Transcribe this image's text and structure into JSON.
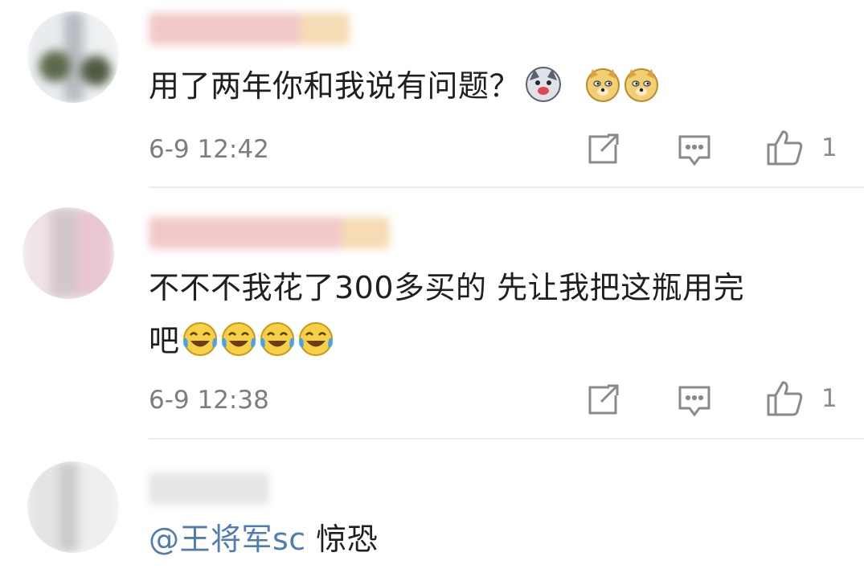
{
  "comments": [
    {
      "text_parts": [
        "用了两年你和我说有问题？"
      ],
      "emojis": [
        "husky-emoji",
        "doge-emoji",
        "doge-emoji"
      ],
      "time": "6-9 12:42",
      "likes": "1"
    },
    {
      "text_parts": [
        "不不不我花了300多买的 先让我把这瓶用完",
        "吧"
      ],
      "emojis": [
        "laugh-cry-emoji",
        "laugh-cry-emoji",
        "laugh-cry-emoji",
        "laugh-cry-emoji"
      ],
      "time": "6-9 12:38",
      "likes": "1"
    },
    {
      "mention": "@王将军sc",
      "text": " 惊恐"
    }
  ],
  "colors": {
    "text": "#1f1f1f",
    "meta": "#7d7d7d",
    "mention": "#507daf",
    "divider": "#ececec"
  }
}
